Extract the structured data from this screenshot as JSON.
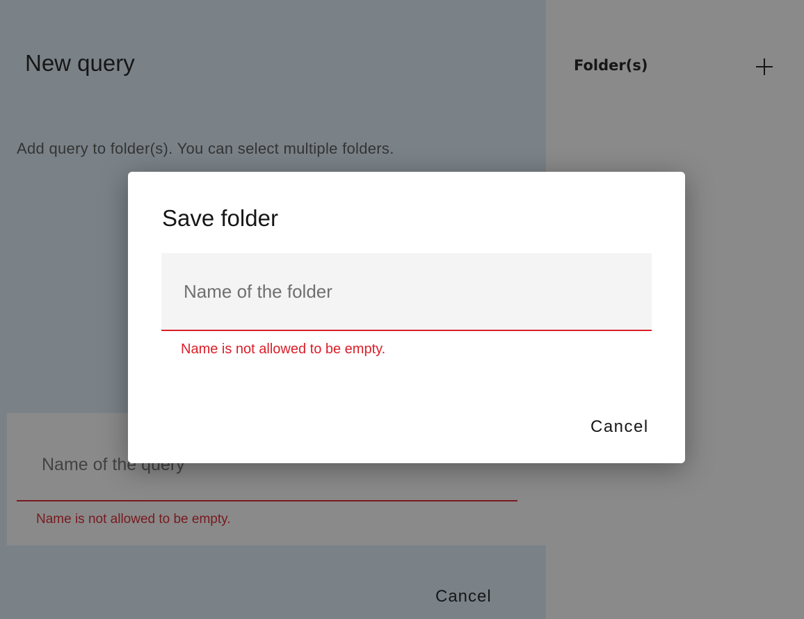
{
  "page": {
    "title": "New query",
    "description": "Add query to folder(s). You can select multiple folders.",
    "query_name": {
      "value": "",
      "placeholder": "Name of the query",
      "error": "Name is not allowed to be empty."
    },
    "cancel_label": "Cancel"
  },
  "folders_panel": {
    "title": "Folder(s)",
    "add_icon": "plus-icon"
  },
  "modal": {
    "title": "Save folder",
    "folder_name": {
      "value": "",
      "placeholder": "Name of the folder",
      "error": "Name is not allowed to be empty."
    },
    "cancel_label": "Cancel"
  },
  "colors": {
    "error": "#da1e28",
    "left_panel_bg": "#dfeefb",
    "field_bg": "#f4f4f4",
    "text": "#161616",
    "overlay": "rgba(22,22,22,0.5)"
  }
}
